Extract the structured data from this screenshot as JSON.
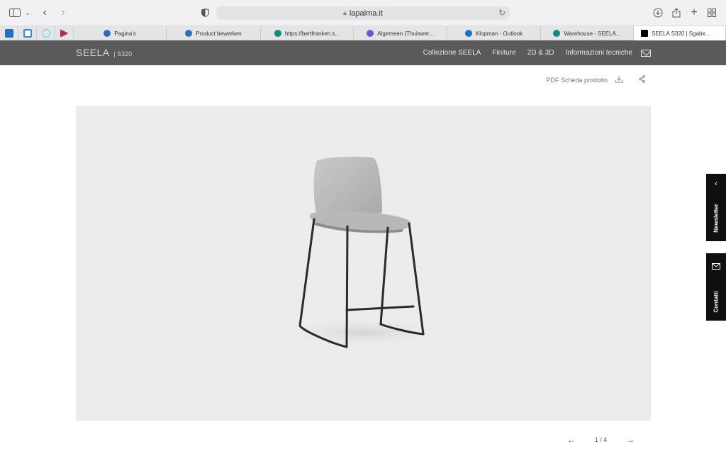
{
  "browser": {
    "url": "lapalma.it",
    "pinned": [
      {
        "icon": "outlook-icon",
        "color": "#1f6fc6"
      },
      {
        "icon": "calendar-icon",
        "color": "#3b82f6"
      },
      {
        "icon": "react-icon",
        "color": "#5ad1f0"
      },
      {
        "icon": "media-icon",
        "color": "#c0245c"
      }
    ],
    "tabs": [
      {
        "label": "Pagina's",
        "color": "#2d6fb8"
      },
      {
        "label": "Product bewerken",
        "color": "#2d6fb8"
      },
      {
        "label": "https://bertfranken.s...",
        "color": "#0f8a7e"
      },
      {
        "label": "Algemeen (Thuiswer...",
        "color": "#5b5fc7"
      },
      {
        "label": "Klopman - Outlook",
        "color": "#1f6fc6"
      },
      {
        "label": "Warehouse - SEELA...",
        "color": "#0f8a7e"
      },
      {
        "label": "SEELA S320 | Sgabe...",
        "color": "#000000"
      }
    ]
  },
  "site": {
    "brand": "SEELA",
    "model": "| S320",
    "nav": [
      "Collezione SEELA",
      "Finiture",
      "2D & 3D",
      "Informazioni tecniche"
    ]
  },
  "utility": {
    "pdf_label": "PDF Scheda prodotto"
  },
  "pager": {
    "indicator": "1 / 4",
    "prev": "←",
    "next": "→"
  },
  "side": {
    "newsletter": "Newsletter",
    "contacts": "Contatti"
  },
  "colors": {
    "header_bg": "#5a5a5a",
    "stage_bg": "#ececec",
    "side_bg": "#0f0f0f"
  }
}
